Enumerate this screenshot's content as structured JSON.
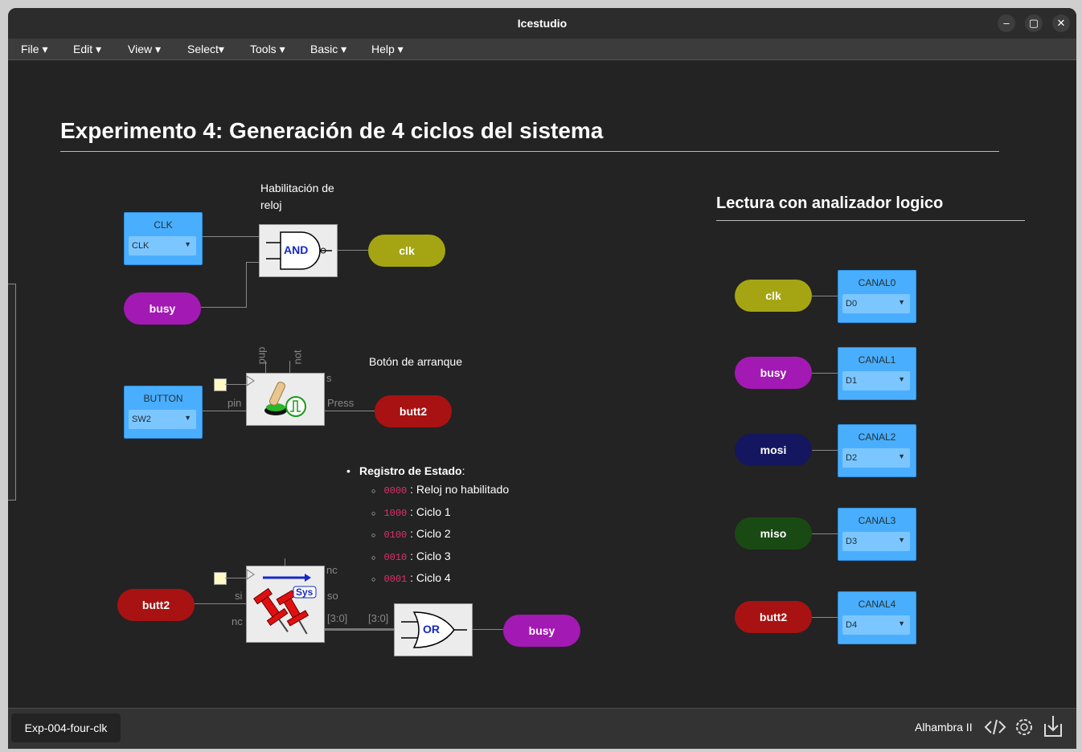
{
  "window": {
    "title": "Icestudio"
  },
  "menu": {
    "items": [
      "File",
      "Edit",
      "View",
      "Select",
      "Tools",
      "Basic",
      "Help"
    ]
  },
  "canvas": {
    "title": "Experimento 4: Generación de 4 ciclos del sistema",
    "subtitle": "Lectura con analizador logico",
    "comment_clock": "Habilitación de reloj",
    "comment_button": "Botón de arranque",
    "state_register": {
      "label": "Registro de Estado",
      "items": [
        {
          "code": "0000",
          "text": ": Reloj no habilitado"
        },
        {
          "code": "1000",
          "text": ": Ciclo 1"
        },
        {
          "code": "0100",
          "text": ": Ciclo 2"
        },
        {
          "code": "0010",
          "text": ": Ciclo 3"
        },
        {
          "code": "0001",
          "text": ": Ciclo 4"
        }
      ]
    },
    "inputs": {
      "clk": {
        "label": "CLK",
        "value": "CLK"
      },
      "button": {
        "label": "BUTTON",
        "value": "SW2"
      }
    },
    "gates": {
      "and": "AND",
      "or": "OR"
    },
    "labels": {
      "clk_out": "clk",
      "busy_in": "busy",
      "butt2_out": "butt2",
      "butt2_in": "butt2",
      "busy_out": "busy"
    },
    "button_block": {
      "pup": "pup",
      "not": "not",
      "s": "s",
      "pin": "pin",
      "press": "Press"
    },
    "sys_block": {
      "badge": "Sys",
      "nc_top": "nc",
      "si": "si",
      "so": "so",
      "nc_left": "nc",
      "bus_out": "[3:0]",
      "bus_in": "[3:0]"
    },
    "analyzer": [
      {
        "tag": "clk",
        "channel": "CANAL0",
        "pin": "D0",
        "color": "#a5a514"
      },
      {
        "tag": "busy",
        "channel": "CANAL1",
        "pin": "D1",
        "color": "#a319b4"
      },
      {
        "tag": "mosi",
        "channel": "CANAL2",
        "pin": "D2",
        "color": "#141660"
      },
      {
        "tag": "miso",
        "channel": "CANAL3",
        "pin": "D3",
        "color": "#1a4a14"
      },
      {
        "tag": "butt2",
        "channel": "CANAL4",
        "pin": "D4",
        "color": "#a81212"
      }
    ]
  },
  "status": {
    "project_tab": "Exp-004-four-clk",
    "board": "Alhambra II"
  },
  "colors": {
    "olive": "#a5a514",
    "purple": "#a319b4",
    "red": "#a81212",
    "io_blue": "#4aaeff"
  }
}
